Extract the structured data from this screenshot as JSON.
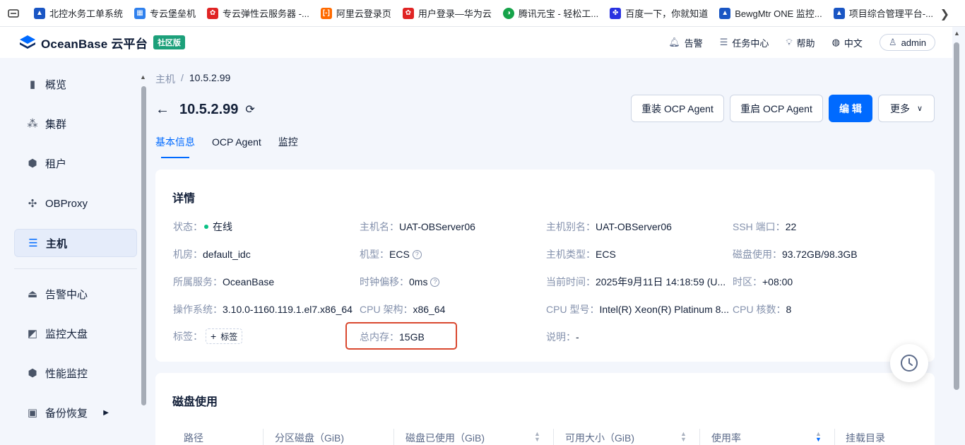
{
  "bookmarks": [
    {
      "label": "北控水务工单系统",
      "icon": "beikong-icon",
      "color": "#1a56c4"
    },
    {
      "label": "专云堡垒机",
      "icon": "bastion-icon",
      "color": "#2f80ed"
    },
    {
      "label": "专云弹性云服务器 -...",
      "icon": "huawei-icon",
      "color": "#e02424"
    },
    {
      "label": "阿里云登录页",
      "icon": "aliyun-icon",
      "color": "#ff6a00"
    },
    {
      "label": "用户登录—华为云",
      "icon": "huawei-icon",
      "color": "#e02424"
    },
    {
      "label": "腾讯元宝 - 轻松工...",
      "icon": "yuanbao-icon",
      "color": "#16a34a"
    },
    {
      "label": "百度一下，你就知道",
      "icon": "baidu-icon",
      "color": "#2932e1"
    },
    {
      "label": "BewgMtr ONE 监控...",
      "icon": "bewg-icon",
      "color": "#1a56c4"
    },
    {
      "label": "项目综合管理平台-...",
      "icon": "project-icon",
      "color": "#1a56c4"
    }
  ],
  "header": {
    "logo_text": "OceanBase 云平台",
    "badge": "社区版",
    "links": [
      {
        "label": "告警",
        "icon": "bell-icon"
      },
      {
        "label": "任务中心",
        "icon": "list-icon"
      },
      {
        "label": "帮助",
        "icon": "bulb-icon"
      },
      {
        "label": "中文",
        "icon": "globe-icon"
      }
    ],
    "user": "admin"
  },
  "sidebar": {
    "items": [
      {
        "label": "概览",
        "icon": "bar-chart-icon"
      },
      {
        "label": "集群",
        "icon": "cluster-icon"
      },
      {
        "label": "租户",
        "icon": "tenant-icon"
      },
      {
        "label": "OBProxy",
        "icon": "proxy-icon"
      },
      {
        "label": "主机",
        "icon": "host-icon",
        "active": true
      },
      {
        "label": "告警中心",
        "icon": "alarm-icon"
      },
      {
        "label": "监控大盘",
        "icon": "monitor-icon"
      },
      {
        "label": "性能监控",
        "icon": "performance-icon"
      },
      {
        "label": "备份恢复",
        "icon": "backup-icon",
        "has_submenu": true
      }
    ]
  },
  "breadcrumb": {
    "parent": "主机",
    "separator": "/",
    "current": "10.5.2.99"
  },
  "page": {
    "title": "10.5.2.99",
    "buttons": {
      "reinstall": "重装 OCP Agent",
      "restart": "重启 OCP Agent",
      "edit": "编 辑",
      "more": "更多"
    },
    "tabs": [
      "基本信息",
      "OCP Agent",
      "监控"
    ],
    "active_tab": 0
  },
  "details": {
    "title": "详情",
    "status_label": "状态：",
    "status_value": "在线",
    "hostname_label": "主机名：",
    "hostname_value": "UAT-OBServer06",
    "alias_label": "主机别名：",
    "alias_value": "UAT-OBServer06",
    "ssh_label": "SSH 端口：",
    "ssh_value": "22",
    "idc_label": "机房：",
    "idc_value": "default_idc",
    "model_label": "机型：",
    "model_value": "ECS",
    "hosttype_label": "主机类型：",
    "hosttype_value": "ECS",
    "disk_label": "磁盘使用：",
    "disk_value": "93.72GB/98.3GB",
    "service_label": "所属服务：",
    "service_value": "OceanBase",
    "clock_label": "时钟偏移：",
    "clock_value": "0ms",
    "time_label": "当前时间：",
    "time_value": "2025年9月11日 14:18:59 (U...",
    "tz_label": "时区：",
    "tz_value": "+08:00",
    "os_label": "操作系统：",
    "os_value": "3.10.0-1160.119.1.el7.x86_64",
    "arch_label": "CPU 架构：",
    "arch_value": "x86_64",
    "cpumodel_label": "CPU 型号：",
    "cpumodel_value": "Intel(R) Xeon(R) Platinum 8...",
    "cores_label": "CPU 核数：",
    "cores_value": "8",
    "tags_label": "标签：",
    "tags_button": "标签",
    "memory_label": "总内存：",
    "memory_value": "15GB",
    "desc_label": "说明：",
    "desc_value": "-"
  },
  "disk_usage": {
    "title": "磁盘使用",
    "columns": [
      "路径",
      "分区磁盘（GiB)",
      "磁盘已使用（GiB)",
      "可用大小（GiB)",
      "使用率",
      "挂载目录"
    ]
  },
  "colors": {
    "primary": "#006aff",
    "online": "#0ac185",
    "highlight": "#d9482f",
    "brand_badge": "#1ca07a"
  }
}
